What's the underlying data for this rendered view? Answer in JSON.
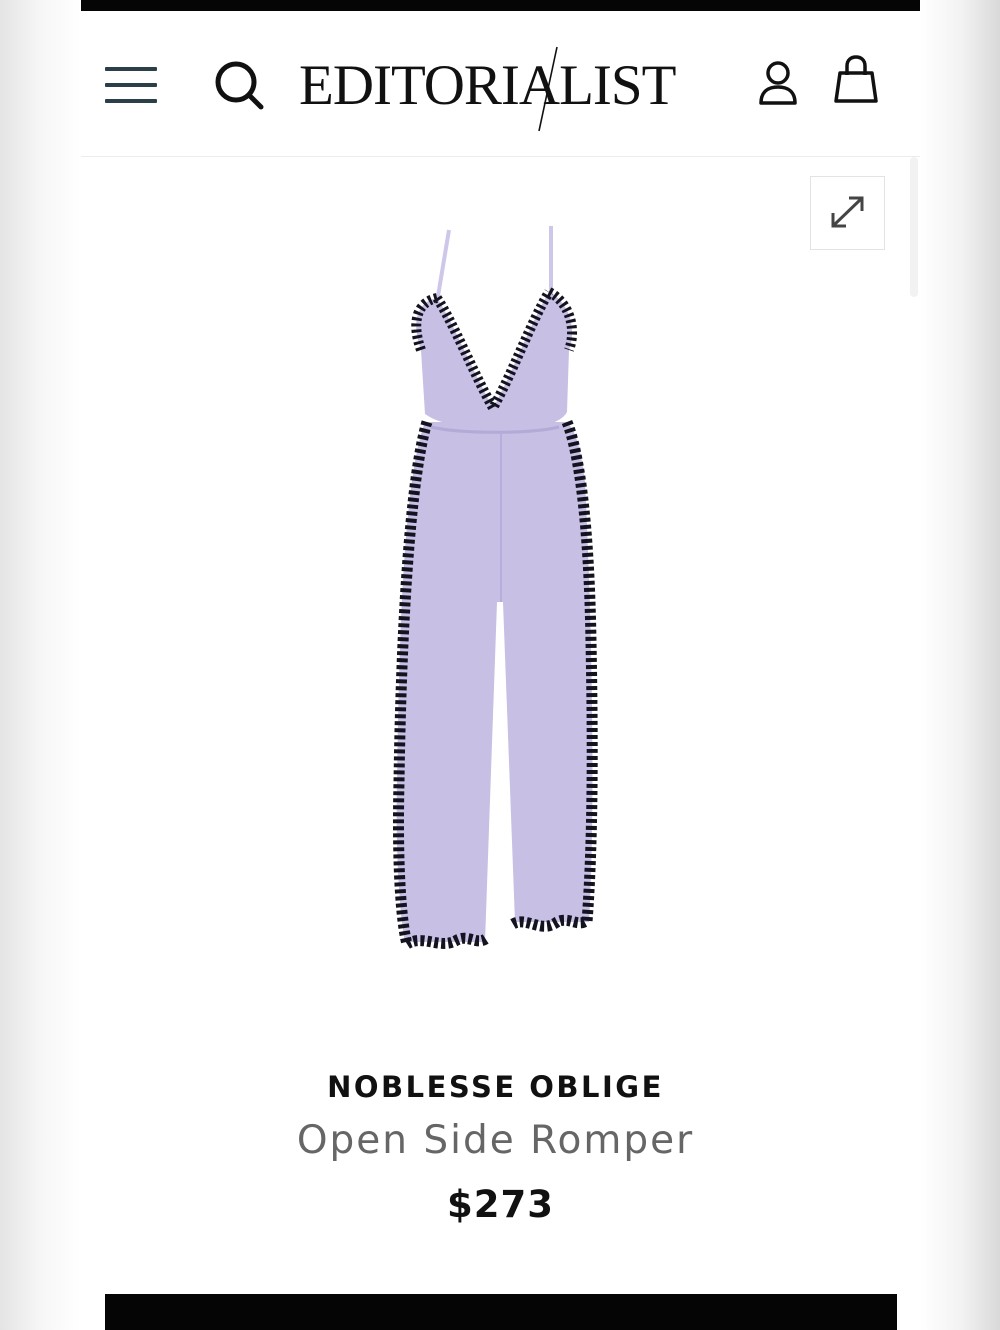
{
  "header": {
    "logo_text": "EDITORIALIST",
    "icons": {
      "menu": "hamburger-menu-icon",
      "search": "search-icon",
      "account": "user-icon",
      "bag": "shopping-bag-icon",
      "expand": "expand-arrows-icon"
    }
  },
  "product": {
    "brand": "NOBLESSE OBLIGE",
    "name": "Open Side Romper",
    "price": "$273",
    "image": "lavender-jumpsuit-with-black-lace-trim",
    "colors": {
      "fabric": "#c7bfe4",
      "lace": "#141420"
    }
  },
  "theme": {
    "text": "#111111",
    "muted_text": "#666666",
    "menu_icon": "#2a3f47",
    "top_bar": "#050505",
    "cta": "#050505"
  }
}
